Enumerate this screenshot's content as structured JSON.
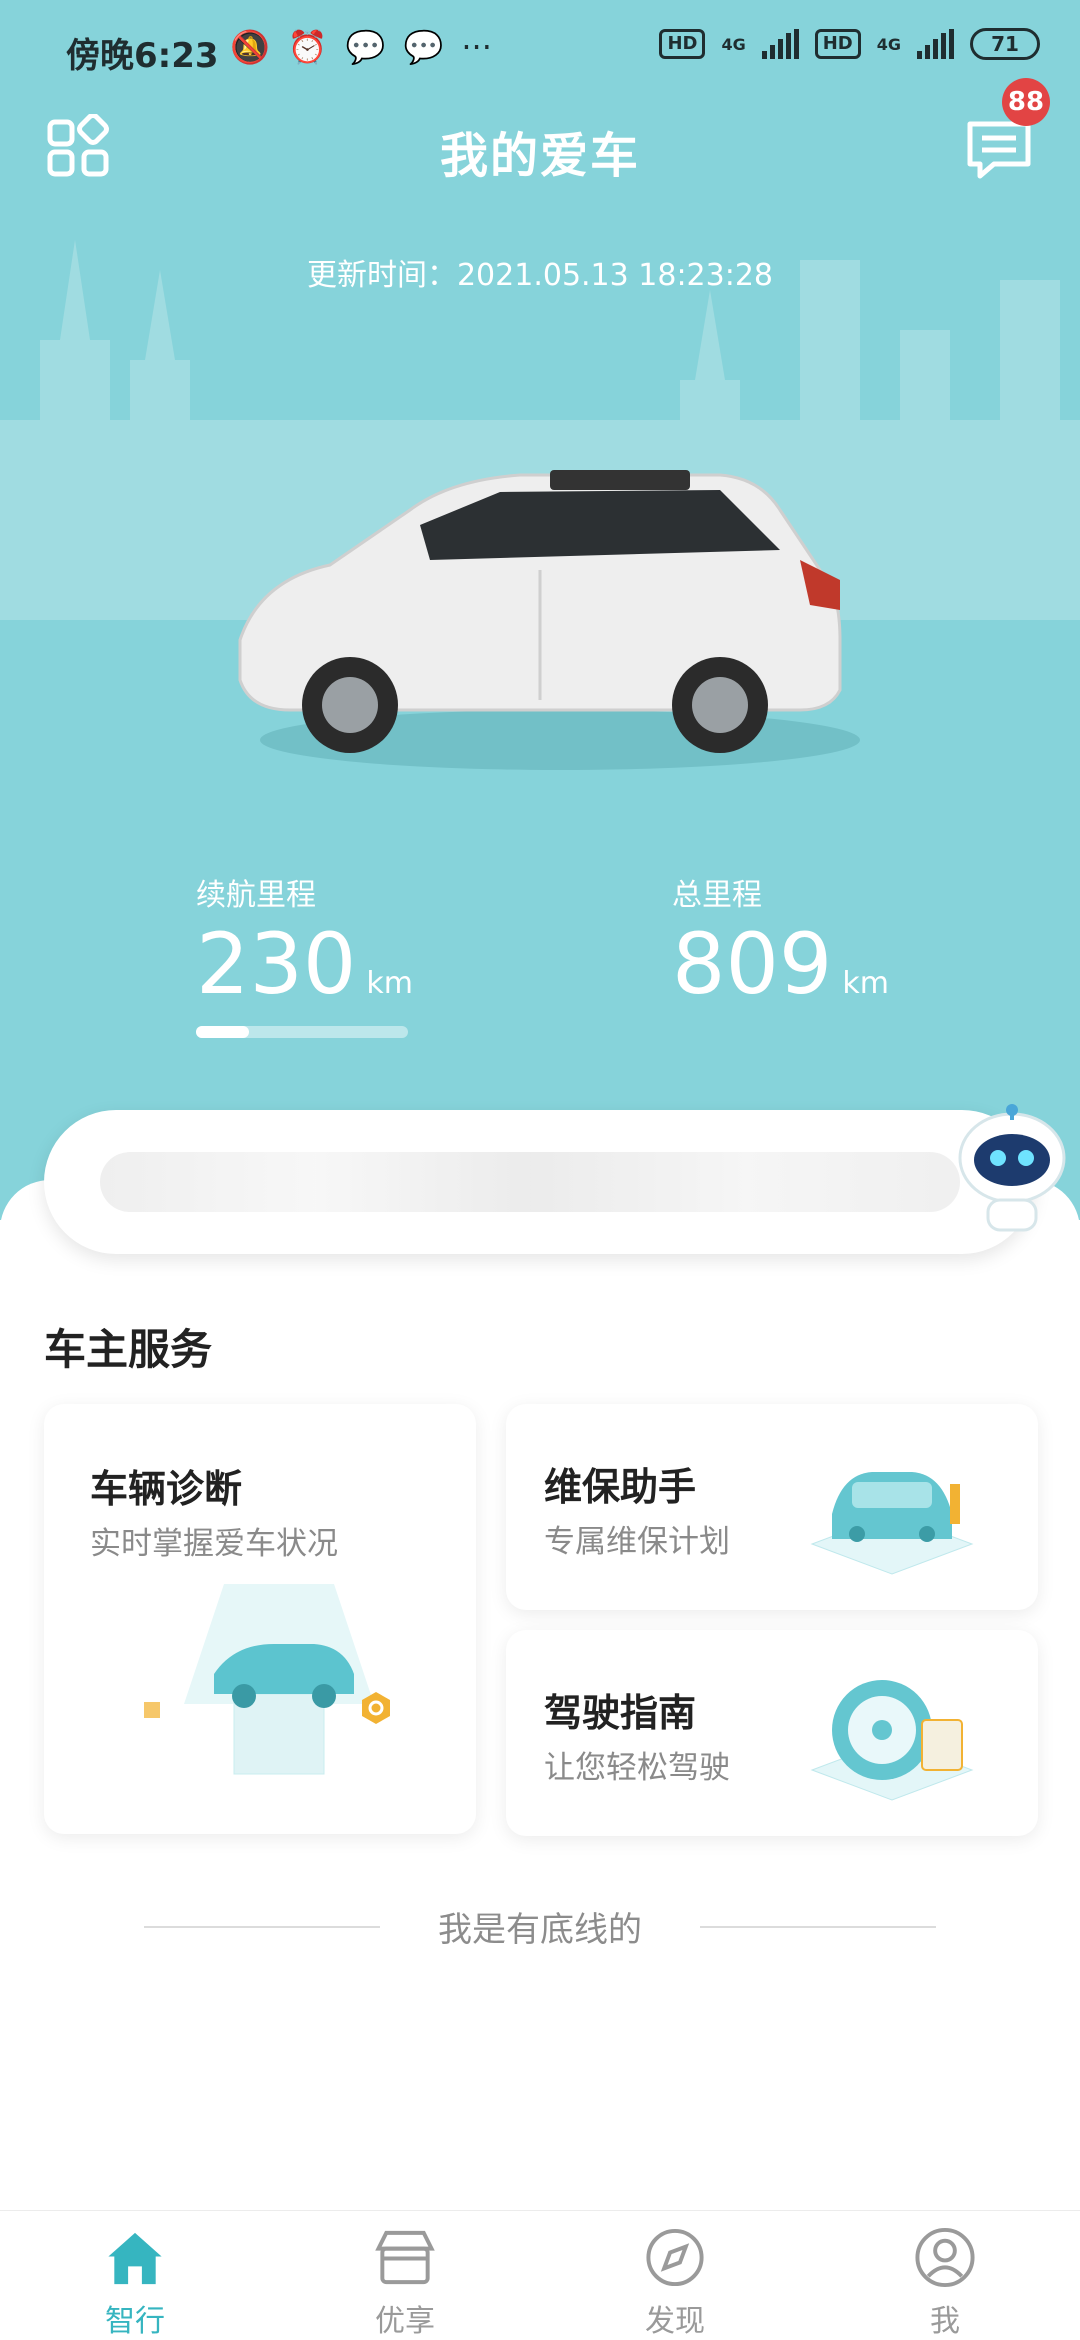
{
  "status_bar": {
    "time": "傍晚6:23",
    "hd1": "HD",
    "hd2": "HD",
    "net1": "4G",
    "net2": "4G",
    "battery": "71"
  },
  "header": {
    "title": "我的爱车",
    "message_badge": "88"
  },
  "update_time": "更新时间：2021.05.13 18:23:28",
  "mileage": {
    "range_label": "续航里程",
    "range_value": "230",
    "range_unit": "km",
    "range_bar_fill": 0.25,
    "total_label": "总里程",
    "total_value": "809",
    "total_unit": "km"
  },
  "services": {
    "section_title": "车主服务",
    "diagnosis": {
      "title": "车辆诊断",
      "subtitle": "实时掌握爱车状况"
    },
    "maintenance": {
      "title": "维保助手",
      "subtitle": "专属维保计划"
    },
    "guide": {
      "title": "驾驶指南",
      "subtitle": "让您轻松驾驶"
    }
  },
  "footer_note": "我是有底线的",
  "tabbar": {
    "tabs": [
      {
        "label": "智行",
        "icon": "home-icon",
        "active": true
      },
      {
        "label": "优享",
        "icon": "shop-icon",
        "active": false
      },
      {
        "label": "发现",
        "icon": "compass-icon",
        "active": false
      },
      {
        "label": "我",
        "icon": "user-icon",
        "active": false
      }
    ]
  },
  "colors": {
    "hero_bg": "#86d3da",
    "accent": "#36b5c0",
    "badge": "#e24444"
  }
}
